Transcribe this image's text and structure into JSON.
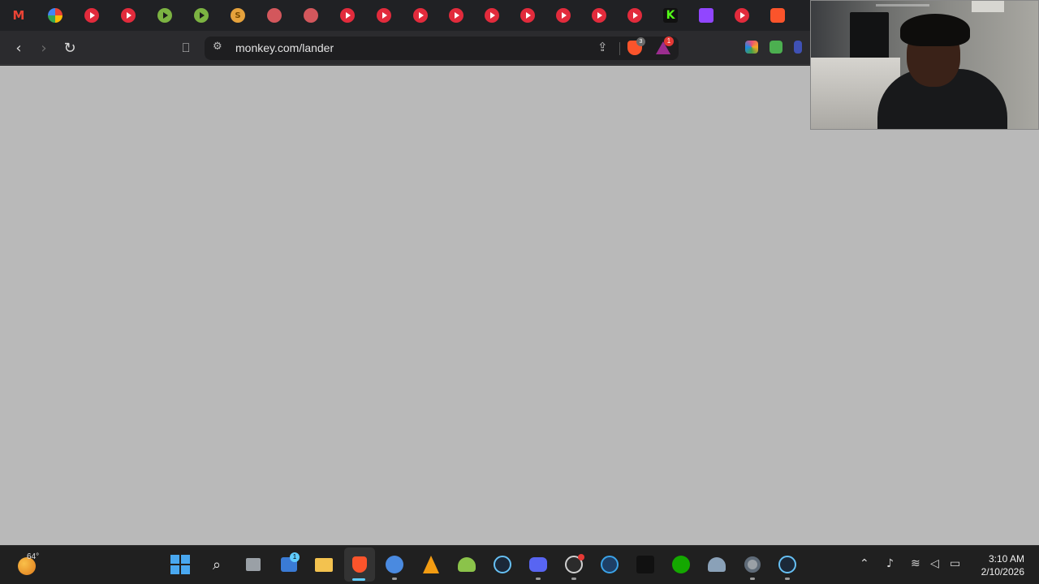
{
  "browser": {
    "url": "monkey.com/lander",
    "shields_count": "3",
    "rewards_count": "1",
    "tabs": [
      {
        "icon": "gmail-icon",
        "glyph": "M"
      },
      {
        "icon": "google-multicolor-icon",
        "glyph": ""
      },
      {
        "icon": "youtube-icon",
        "glyph": ""
      },
      {
        "icon": "youtube-icon",
        "glyph": ""
      },
      {
        "icon": "play-icon",
        "glyph": ""
      },
      {
        "icon": "play-icon",
        "glyph": ""
      },
      {
        "icon": "coin-icon",
        "glyph": "S"
      },
      {
        "icon": "shield-icon",
        "glyph": ""
      },
      {
        "icon": "shield-icon",
        "glyph": ""
      },
      {
        "icon": "youtube-icon",
        "glyph": ""
      },
      {
        "icon": "youtube-icon",
        "glyph": ""
      },
      {
        "icon": "youtube-icon",
        "glyph": ""
      },
      {
        "icon": "youtube-icon",
        "glyph": ""
      },
      {
        "icon": "youtube-icon",
        "glyph": ""
      },
      {
        "icon": "youtube-icon",
        "glyph": ""
      },
      {
        "icon": "youtube-icon",
        "glyph": ""
      },
      {
        "icon": "youtube-icon",
        "glyph": ""
      },
      {
        "icon": "youtube-icon",
        "glyph": ""
      },
      {
        "icon": "kick-icon",
        "glyph": "K"
      },
      {
        "icon": "twitch-icon",
        "glyph": ""
      },
      {
        "icon": "youtube-icon",
        "glyph": ""
      },
      {
        "icon": "brave-icon",
        "glyph": ""
      }
    ]
  },
  "taskbar": {
    "weather_temp": "64°",
    "store_badge": "1",
    "time": "3:10 AM",
    "date": "2/10/2026",
    "apps": [
      "windows-start-icon",
      "search-icon",
      "task-view-icon",
      "store-icon",
      "file-explorer-icon",
      "brave-browser-icon",
      "cloud-icon",
      "vlc-icon",
      "android-icon",
      "steam-icon",
      "discord-icon",
      "obs-icon",
      "ccleaner-icon",
      "terminal-icon",
      "upwork-icon",
      "helmet-icon",
      "settings-icon",
      "steam-icon"
    ]
  },
  "colors": {
    "page_background": "#b9b9b9",
    "accent": "#60cdff",
    "youtube_red": "#e22b3c"
  }
}
